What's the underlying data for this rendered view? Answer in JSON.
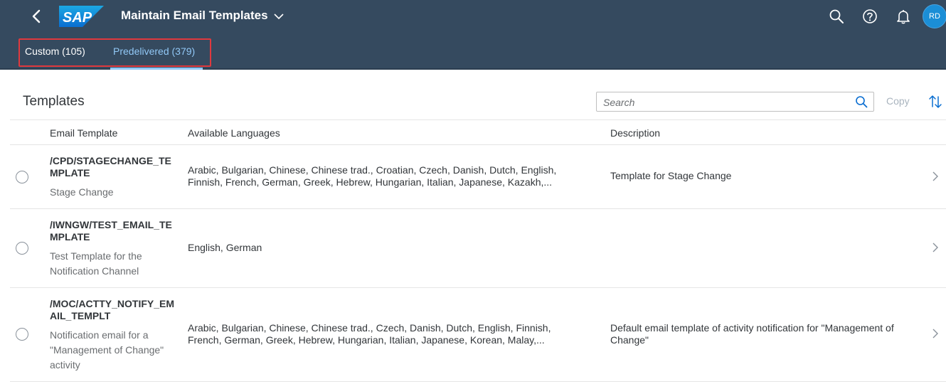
{
  "shell": {
    "app_title": "Maintain Email Templates",
    "avatar_initials": "RD",
    "brand_color": "#354a5f",
    "logo_text": "SAP"
  },
  "tabs": [
    {
      "label": "Custom (105)",
      "selected": false
    },
    {
      "label": "Predelivered (379)",
      "selected": true
    }
  ],
  "toolbar": {
    "title": "Templates",
    "search_placeholder": "Search",
    "copy_label": "Copy"
  },
  "table": {
    "columns": [
      "Email Template",
      "Available Languages",
      "Description"
    ],
    "rows": [
      {
        "id": "/CPD/STAGECHANGE_TEMPLATE",
        "name": "Stage Change",
        "languages": "Arabic, Bulgarian, Chinese, Chinese trad., Croatian, Czech, Danish, Dutch, English, Finnish, French, German, Greek, Hebrew, Hungarian, Italian, Japanese, Kazakh,...",
        "description": "Template for Stage Change"
      },
      {
        "id": "/IWNGW/TEST_EMAIL_TEMPLATE",
        "name": "Test Template for the Notification Channel",
        "languages": "English, German",
        "description": ""
      },
      {
        "id": "/MOC/ACTTY_NOTIFY_EMAIL_TEMPLT",
        "name": "Notification email for a \"Management of Change\" activity",
        "languages": "Arabic, Bulgarian, Chinese, Chinese trad., Czech, Danish, Dutch, English, Finnish, French, German, Greek, Hebrew, Hungarian, Italian, Japanese, Korean, Malay,...",
        "description": "Default email template of activity notification for \"Management of Change\""
      }
    ]
  }
}
